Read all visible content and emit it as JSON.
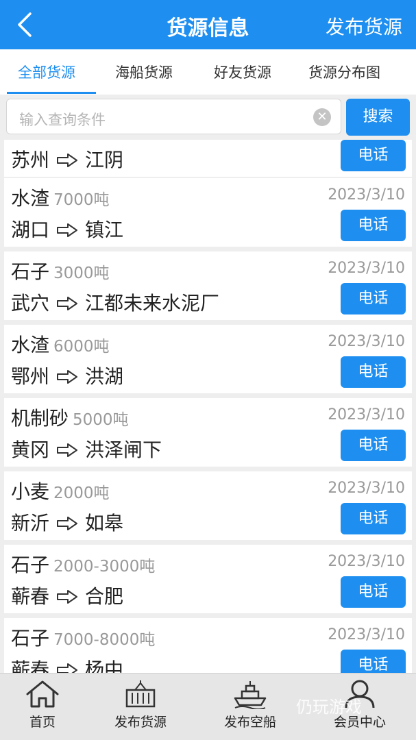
{
  "header": {
    "title": "货源信息",
    "publish_label": "发布货源"
  },
  "tabs": [
    {
      "label": "全部货源",
      "active": true
    },
    {
      "label": "海船货源",
      "active": false
    },
    {
      "label": "好友货源",
      "active": false
    },
    {
      "label": "货源分布图",
      "active": false
    }
  ],
  "search": {
    "placeholder": "输入查询条件",
    "button_label": "搜索"
  },
  "partial_card": {
    "from": "苏州",
    "to": "江阴",
    "call_label": "电话"
  },
  "cards": [
    {
      "cargo": "水渣",
      "qty": "7000吨",
      "date": "2023/3/10",
      "from": "湖口",
      "to": "镇江",
      "call_label": "电话"
    },
    {
      "cargo": "石子",
      "qty": "3000吨",
      "date": "2023/3/10",
      "from": "武穴",
      "to": "江都未来水泥厂",
      "call_label": "电话"
    },
    {
      "cargo": "水渣",
      "qty": "6000吨",
      "date": "2023/3/10",
      "from": "鄂州",
      "to": "洪湖",
      "call_label": "电话"
    },
    {
      "cargo": "机制砂",
      "qty": "5000吨",
      "date": "2023/3/10",
      "from": "黄冈",
      "to": "洪泽闸下",
      "call_label": "电话"
    },
    {
      "cargo": "小麦",
      "qty": "2000吨",
      "date": "2023/3/10",
      "from": "新沂",
      "to": "如皋",
      "call_label": "电话"
    },
    {
      "cargo": "石子",
      "qty": "2000-3000吨",
      "date": "2023/3/10",
      "from": "蕲春",
      "to": "合肥",
      "call_label": "电话"
    },
    {
      "cargo": "石子",
      "qty": "7000-8000吨",
      "date": "2023/3/10",
      "from": "蕲春",
      "to": "杨中",
      "call_label": "电话"
    }
  ],
  "bottom_nav": [
    {
      "label": "首页",
      "icon": "home-icon"
    },
    {
      "label": "发布货源",
      "icon": "container-icon"
    },
    {
      "label": "发布空船",
      "icon": "ship-icon"
    },
    {
      "label": "会员中心",
      "icon": "user-icon"
    }
  ],
  "watermark": "仍玩游戏",
  "colors": {
    "primary": "#1e8ff0",
    "muted": "#999999",
    "background": "#eeeeee"
  }
}
